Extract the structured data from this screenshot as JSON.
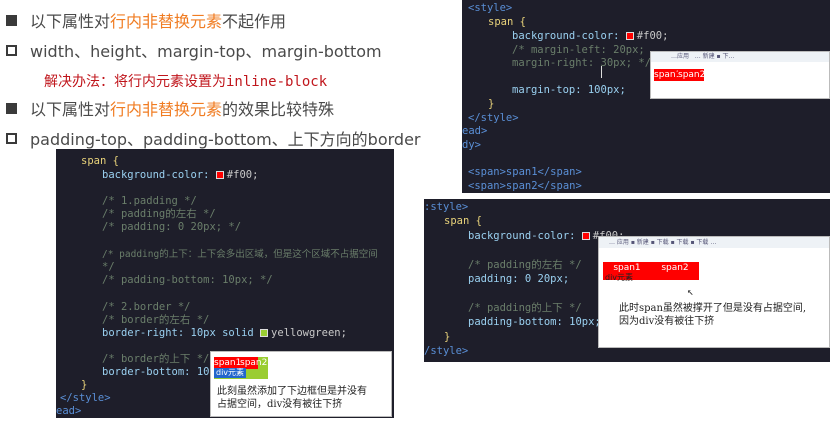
{
  "bullets": [
    {
      "pre": "以下属性对",
      "hl": "行内非替换元素",
      "post": "不起作用"
    },
    {
      "pre": "width、height、margin-top、margin-bottom",
      "hl": "",
      "post": ""
    },
    {
      "pre": "以下属性对",
      "hl": "行内非替换元素",
      "post": "的效果比较特殊"
    },
    {
      "pre": "padding-top、padding-bottom、上下方向的border",
      "hl": "",
      "post": ""
    }
  ],
  "solution": {
    "text": "解决办法：将行内元素设置为",
    "code": "inline-block"
  },
  "panel_tr": {
    "lines": [
      "<style>",
      "span {",
      "background-color:",
      "/* margin-left: 20px;",
      "margin-right: 30px; */",
      "margin-top: 100px;",
      "}",
      "</style>",
      "ead>",
      "dy>",
      "<span>span1</span>",
      "<span>span2</span>"
    ],
    "bg_value": "#f00;",
    "demo": {
      "spans": [
        "span1",
        "span2"
      ],
      "toolbar": "…应用   … 新建 ▪ 下…"
    }
  },
  "panel_left": {
    "lines": [
      "span {",
      "background-color:",
      "/* 1.padding */",
      "/* padding的左右 */",
      "/* padding: 0 20px; */",
      "/* padding的上下：上下会多出区域，但是这个区域不占据空间",
      "*/",
      "/* padding-bottom: 10px; */",
      "/* 2.border */",
      "/* border的左右 */",
      "border-right: 10px solid",
      "/* border的上下 */",
      "border-bottom: 10",
      "}",
      "</style>",
      "ead>"
    ],
    "bg_value": "#f00;",
    "border_color": "yellowgreen;",
    "cursor_end": "x;",
    "demo": {
      "spans": [
        "span1",
        "span2"
      ],
      "div_label": "div元素",
      "note": "此刻虽然添加了下边框但是并没有\n占据空间，div没有被往下挤"
    }
  },
  "panel_br": {
    "lines": [
      ":style>",
      "span {",
      "background-color:",
      "/* padding的左右 */",
      "padding: 0 20px;",
      "/* padding的上下 */",
      "padding-bottom: 10px;",
      "}",
      "/style>"
    ],
    "bg_value": "#f00;",
    "demo": {
      "spans": [
        "span1",
        "span2"
      ],
      "div_label": "div元素",
      "note": "此时span虽然被撑开了但是没有占据空间,\n因为div没有被往下挤",
      "toolbar": "… 应用 ▪ 新建 ▪ 下载 ▪ 下载 ▪ 下载 …"
    }
  },
  "colors": {
    "highlight": "#f07c22",
    "solution": "#c0161c",
    "panel_bg": "#1e1e2a",
    "red": "#ff0000",
    "yellowgreen": "#9acd32"
  }
}
